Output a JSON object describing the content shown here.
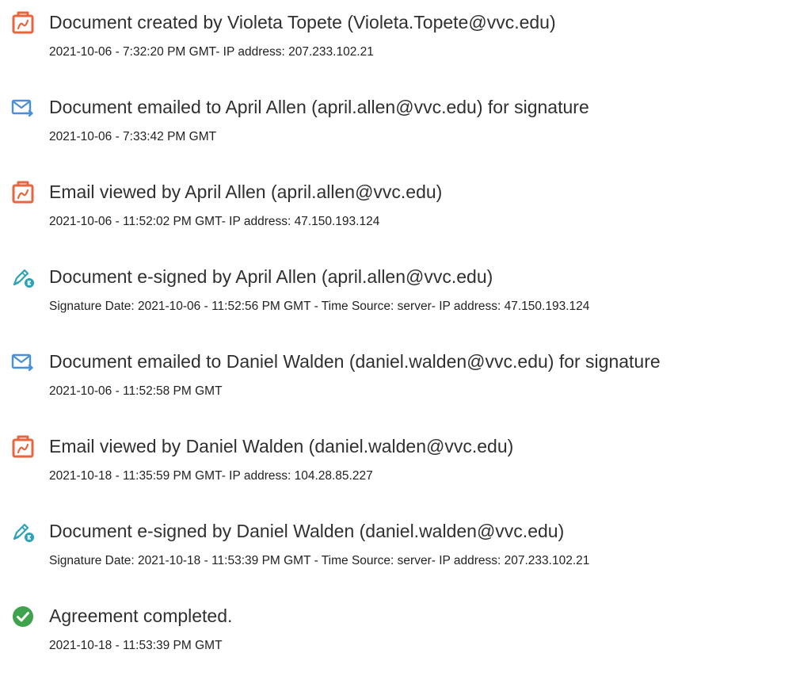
{
  "colors": {
    "doc_icon": "#E8663D",
    "mail_icon": "#4A90D9",
    "sign_icon": "#2EA3B8",
    "check_icon": "#3FA34D"
  },
  "events": [
    {
      "icon": "document-icon",
      "title": "Document created by Violeta Topete (Violeta.Topete@vvc.edu)",
      "meta": "2021-10-06 - 7:32:20 PM GMT- IP address: 207.233.102.21"
    },
    {
      "icon": "email-sent-icon",
      "title": "Document emailed to April Allen (april.allen@vvc.edu) for signature",
      "meta": "2021-10-06 - 7:33:42 PM GMT"
    },
    {
      "icon": "document-icon",
      "title": "Email viewed by April Allen (april.allen@vvc.edu)",
      "meta": "2021-10-06 - 11:52:02 PM GMT- IP address: 47.150.193.124"
    },
    {
      "icon": "esign-pen-icon",
      "title": "Document e-signed by April Allen (april.allen@vvc.edu)",
      "meta": "Signature Date: 2021-10-06 - 11:52:56 PM GMT - Time Source: server- IP address: 47.150.193.124"
    },
    {
      "icon": "email-sent-icon",
      "title": "Document emailed to Daniel Walden (daniel.walden@vvc.edu) for signature",
      "meta": "2021-10-06 - 11:52:58 PM GMT"
    },
    {
      "icon": "document-icon",
      "title": "Email viewed by Daniel Walden (daniel.walden@vvc.edu)",
      "meta": "2021-10-18 - 11:35:59 PM GMT- IP address: 104.28.85.227"
    },
    {
      "icon": "esign-pen-icon",
      "title": "Document e-signed by Daniel Walden (daniel.walden@vvc.edu)",
      "meta": "Signature Date: 2021-10-18 - 11:53:39 PM GMT - Time Source: server- IP address: 207.233.102.21"
    },
    {
      "icon": "check-circle-icon",
      "title": "Agreement completed.",
      "meta": "2021-10-18 - 11:53:39 PM GMT"
    }
  ]
}
